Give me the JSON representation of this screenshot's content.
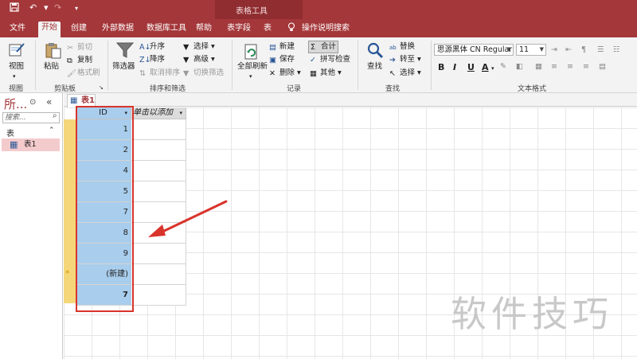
{
  "window": {
    "contextual_tools_label": "表格工具"
  },
  "menu": {
    "tabs": [
      "文件",
      "开始",
      "创建",
      "外部数据",
      "数据库工具",
      "帮助",
      "表字段",
      "表"
    ],
    "active_tab": "开始",
    "tell_me": "操作说明搜索"
  },
  "ribbon": {
    "view": {
      "view_label": "视图",
      "group": "视图"
    },
    "clipboard": {
      "paste": "粘贴",
      "cut": "剪切",
      "copy": "复制",
      "format_painter": "格式刷",
      "group": "剪贴板"
    },
    "sort_filter": {
      "filter": "筛选器",
      "ascending": "升序",
      "descending": "降序",
      "remove_sort": "取消排序",
      "selection": "选择",
      "advanced": "高级",
      "toggle_filter": "切换筛选",
      "group": "排序和筛选"
    },
    "records": {
      "refresh_all": "全部刷新",
      "new": "新建",
      "save": "保存",
      "delete": "删除",
      "totals": "合计",
      "spelling": "拼写检查",
      "more": "其他",
      "group": "记录"
    },
    "find": {
      "find": "查找",
      "replace": "替换",
      "goto": "转至",
      "select": "选择",
      "group": "查找"
    },
    "text_format": {
      "font_name": "思源黑体 CN Regular",
      "font_size": "11",
      "bold": "B",
      "italic": "I",
      "underline": "U",
      "font_color": "A",
      "group": "文本格式"
    }
  },
  "nav_pane": {
    "title": "所...",
    "search_placeholder": "搜索...",
    "section": "表",
    "items": [
      {
        "label": "表1"
      }
    ]
  },
  "document": {
    "tab_label": "表1",
    "columns": [
      "ID",
      "单击以添加"
    ],
    "rows": [
      "1",
      "2",
      "4",
      "5",
      "7",
      "8",
      "9"
    ],
    "new_row_label": "(新建)",
    "new_row_marker": "*",
    "total_value": "7"
  },
  "watermark": "软件技巧",
  "colors": {
    "brand": "#a4373a",
    "selection": "#a9cdec",
    "highlight_box": "#d9342b",
    "record_selector": "#f5d77a"
  }
}
